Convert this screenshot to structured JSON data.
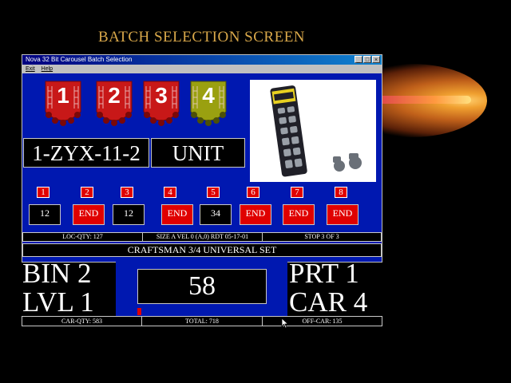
{
  "slide": {
    "title": "BATCH SELECTION SCREEN"
  },
  "window": {
    "title": "Nova 32 Bit Carousel Batch Selection",
    "minimize": "_",
    "maximize": "□",
    "close": "×"
  },
  "menu": {
    "exit": "Exit",
    "help": "Help"
  },
  "carousels": [
    {
      "label": "1",
      "color": "#c81818"
    },
    {
      "label": "2",
      "color": "#c81818"
    },
    {
      "label": "3",
      "color": "#c81818"
    },
    {
      "label": "4",
      "color": "#9aa010"
    }
  ],
  "part": {
    "number": "1-ZYX-11-2",
    "unit": "UNIT"
  },
  "photo": {
    "subject": "socket-set-product-photo"
  },
  "stops": [
    {
      "num": "1",
      "value": "12"
    },
    {
      "num": "2",
      "value": "END"
    },
    {
      "num": "3",
      "value": "12"
    },
    {
      "num": "4",
      "value": "END"
    },
    {
      "num": "5",
      "value": "34"
    },
    {
      "num": "6",
      "value": "END"
    },
    {
      "num": "7",
      "value": "END"
    },
    {
      "num": "8",
      "value": "END"
    }
  ],
  "status": {
    "loc_qty": "LOC-QTY: 127",
    "size": "SIZE A  VEL 0 (A,0)   RDT 05-17-01",
    "stop": "STOP 3 OF 3"
  },
  "description": "CRAFTSMAN 3/4 UNIVERSAL SET",
  "location": {
    "bin": "BIN 2",
    "level": "LVL 1",
    "part": "PRT 1",
    "carousel": "CAR 4"
  },
  "count": "58",
  "totals": {
    "car_qty": "CAR-QTY: 583",
    "total": "TOTAL: 718",
    "off_car": "OFF-CAR: 135"
  },
  "colors": {
    "window_bg": "#0018b0",
    "end_red": "#e00000",
    "title_gold": "#d9a84a"
  }
}
